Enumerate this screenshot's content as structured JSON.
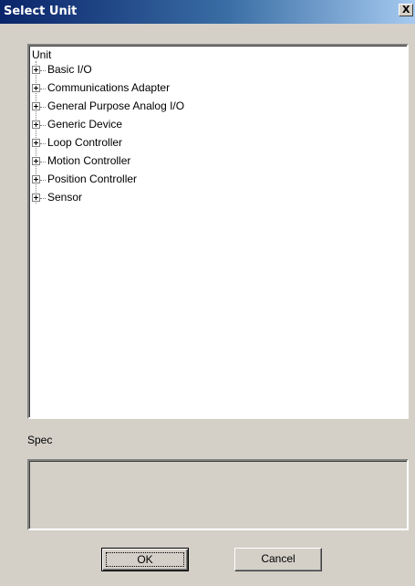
{
  "window": {
    "title": "Select Unit",
    "close_glyph": "X"
  },
  "tree": {
    "root_label": "Unit",
    "items": [
      {
        "label": "Basic I/O"
      },
      {
        "label": "Communications Adapter"
      },
      {
        "label": "General Purpose Analog I/O"
      },
      {
        "label": "Generic Device"
      },
      {
        "label": "Loop Controller"
      },
      {
        "label": "Motion Controller"
      },
      {
        "label": "Position Controller"
      },
      {
        "label": "Sensor"
      }
    ]
  },
  "spec": {
    "label": "Spec",
    "value": ""
  },
  "buttons": {
    "ok_label": "OK",
    "cancel_label": "Cancel"
  }
}
